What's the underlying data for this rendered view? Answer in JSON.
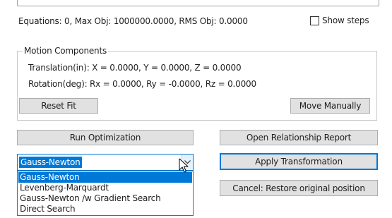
{
  "status": {
    "equations_text": "Equations: 0, Max Obj: 1000000.0000, RMS Obj: 0.0000",
    "show_steps_label": "Show steps",
    "show_steps_checked": false
  },
  "motion": {
    "group_title": "Motion Components",
    "translation_text": "Translation(in):  X =  0.0000, Y =  0.0000, Z =  0.0000",
    "rotation_text": "Rotation(deg):  Rx = 0.0000, Ry = -0.0000, Rz = 0.0000",
    "reset_fit_label": "Reset Fit",
    "move_manually_label": "Move Manually"
  },
  "actions": {
    "run_optimization_label": "Run Optimization",
    "open_report_label": "Open Relationship Report",
    "apply_transformation_label": "Apply Transformation",
    "cancel_restore_label": "Cancel: Restore original position"
  },
  "method": {
    "selected_value": "Gauss-Newton",
    "options": [
      "Gauss-Newton",
      "Levenberg-Marquardt",
      "Gauss-Newton /w Gradient Search",
      "Direct Search"
    ],
    "highlighted_index": 0
  },
  "colors": {
    "accent": "#0078d7",
    "button_face": "#e1e1e1",
    "button_border": "#adadad"
  },
  "icons": {
    "combo_arrow": "chevron-down-icon",
    "pointer": "mouse-pointer-icon"
  }
}
